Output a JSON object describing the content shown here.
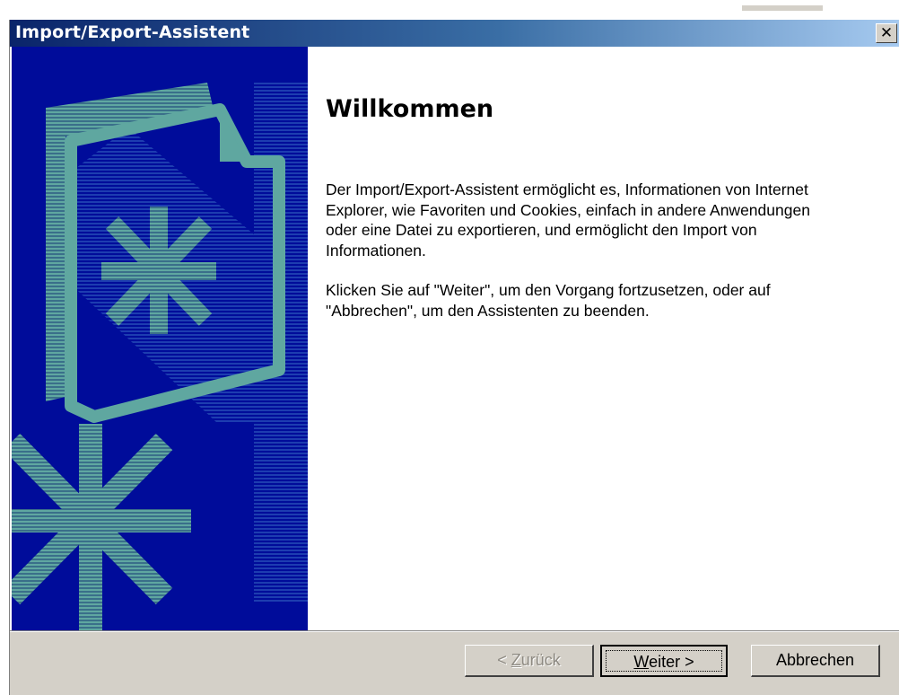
{
  "window": {
    "title": "Import/Export-Assistent",
    "close_glyph": "✕"
  },
  "welcome": {
    "heading": "Willkommen",
    "paragraph1": "Der Import/Export-Assistent ermöglicht es, Informationen von Internet Explorer, wie Favoriten und Cookies, einfach in andere Anwendungen oder eine Datei zu exportieren, und ermöglicht den Import von Informationen.",
    "paragraph2": "Klicken Sie auf \"Weiter\", um den Vorgang fortzusetzen, oder auf \"Abbrechen\", um den Assistenten zu beenden."
  },
  "buttons": {
    "back": {
      "prefix": "< ",
      "accel": "Z",
      "rest": "urück",
      "enabled": false
    },
    "next": {
      "accel": "W",
      "rest": "eiter >",
      "enabled": true,
      "default": true
    },
    "cancel": {
      "label": "Abbrechen",
      "enabled": true
    }
  },
  "colors": {
    "panel_bg": "#000c9a",
    "art_teal": "#5fa7a0",
    "titlebar_start": "#0a246a",
    "titlebar_end": "#a6caf0",
    "dialog_face": "#d4d0c8"
  }
}
